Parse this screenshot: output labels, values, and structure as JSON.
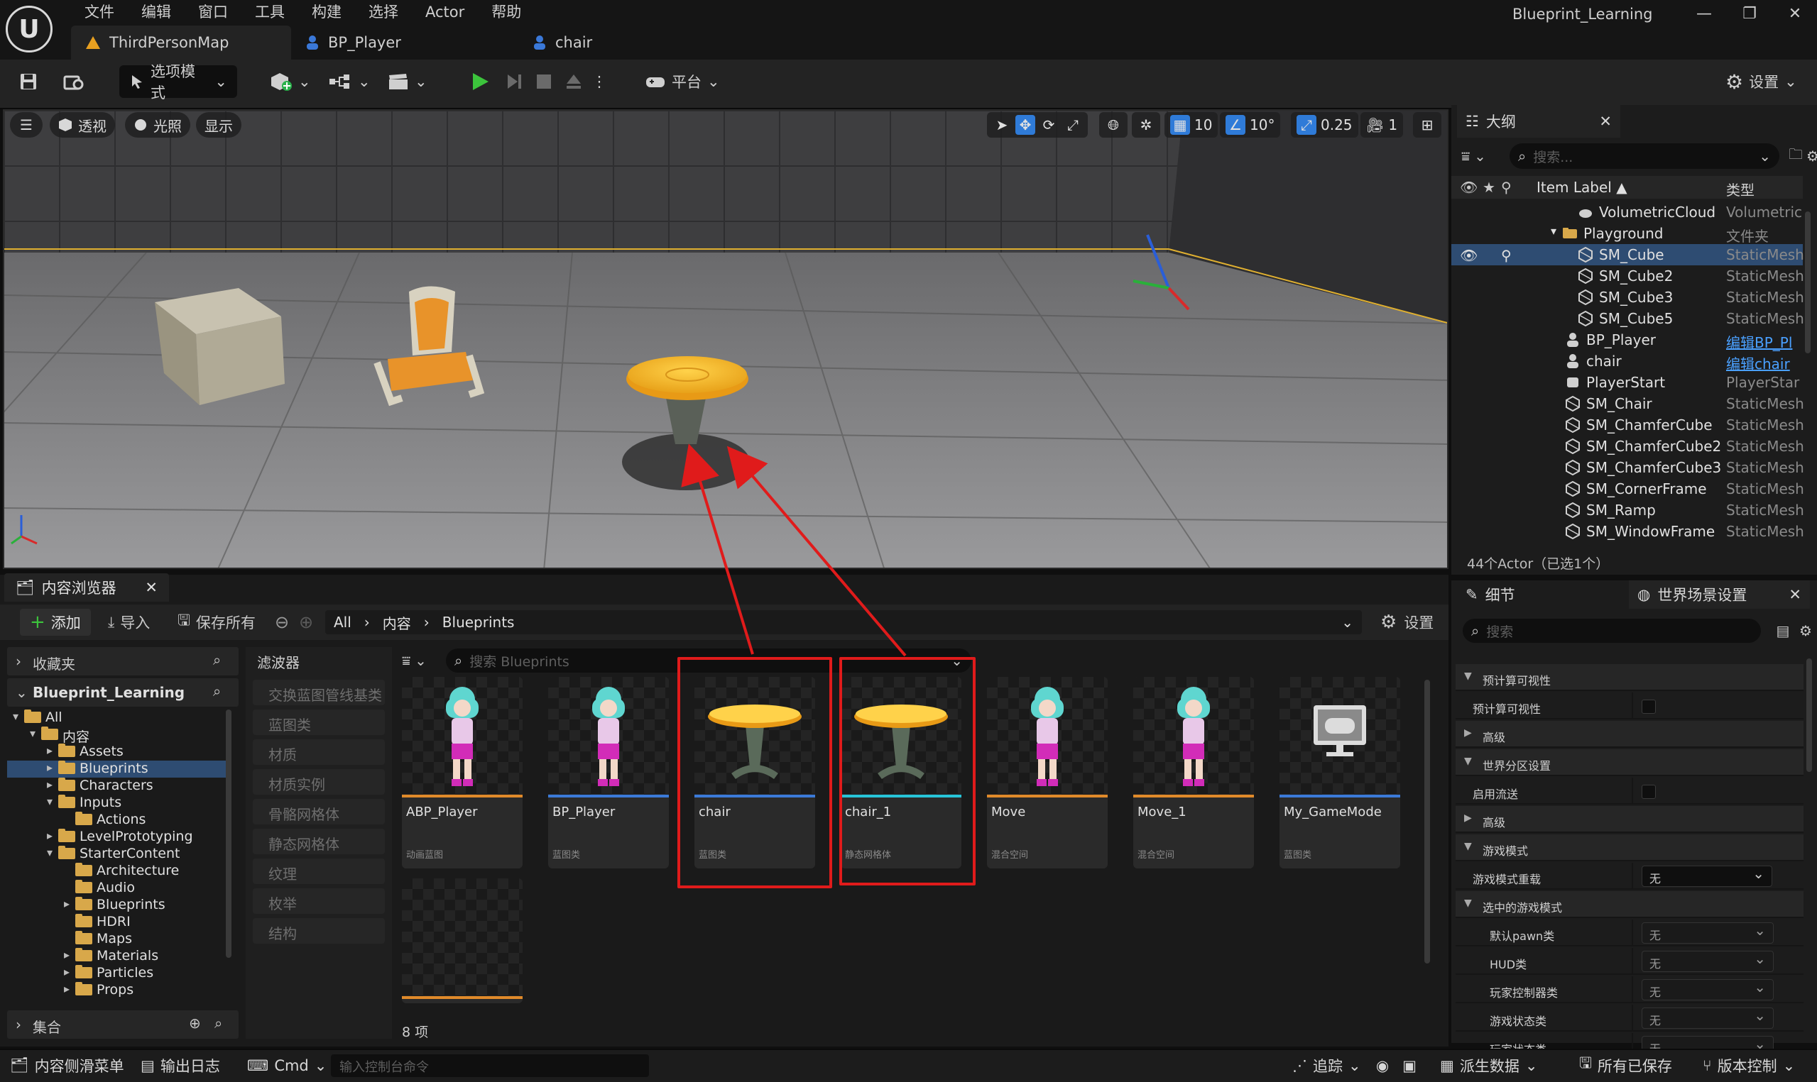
{
  "menu": [
    "文件",
    "编辑",
    "窗口",
    "工具",
    "构建",
    "选择",
    "Actor",
    "帮助"
  ],
  "tabs": [
    {
      "label": "ThirdPersonMap",
      "icon": "map-warning-icon"
    },
    {
      "label": "BP_Player",
      "icon": "blueprint-person-icon"
    },
    {
      "label": "chair",
      "icon": "blueprint-person-icon"
    }
  ],
  "window_title": "Blueprint_Learning",
  "toolbar": {
    "mode_label": "选项模式",
    "platform_label": "平台",
    "settings_label": "设置"
  },
  "viewport": {
    "perspective_label": "透视",
    "lit_label": "光照",
    "show_label": "显示",
    "grid_snap": "10",
    "rotation_snap": "10°",
    "scale_snap": "0.25",
    "camera_speed": "1"
  },
  "outliner": {
    "tab_label": "大纲",
    "search_placeholder": "搜索...",
    "col_label": "Item Label ▲",
    "col_type": "类型",
    "rows": [
      {
        "name": "VolumetricCloud",
        "type": "Volumetric",
        "indent": 1,
        "icon": "cloud-icon"
      },
      {
        "name": "Playground",
        "type": "文件夹",
        "indent": 0,
        "icon": "folder-icon"
      },
      {
        "name": "SM_Cube",
        "type": "StaticMesh",
        "indent": 1,
        "icon": "static-mesh-icon",
        "selected": true
      },
      {
        "name": "SM_Cube2",
        "type": "StaticMesh",
        "indent": 1,
        "icon": "static-mesh-icon"
      },
      {
        "name": "SM_Cube3",
        "type": "StaticMesh",
        "indent": 1,
        "icon": "static-mesh-icon"
      },
      {
        "name": "SM_Cube5",
        "type": "StaticMesh",
        "indent": 1,
        "icon": "static-mesh-icon"
      },
      {
        "name": "BP_Player",
        "type": "编辑BP_Pl",
        "indent": 0,
        "icon": "pawn-icon",
        "link": true
      },
      {
        "name": "chair",
        "type": "编辑chair",
        "indent": 0,
        "icon": "pawn-icon",
        "link": true
      },
      {
        "name": "PlayerStart",
        "type": "PlayerStar",
        "indent": 0,
        "icon": "player-start-icon"
      },
      {
        "name": "SM_Chair",
        "type": "StaticMesh",
        "indent": 0,
        "icon": "static-mesh-icon"
      },
      {
        "name": "SM_ChamferCube",
        "type": "StaticMesh",
        "indent": 0,
        "icon": "static-mesh-icon"
      },
      {
        "name": "SM_ChamferCube2",
        "type": "StaticMesh",
        "indent": 0,
        "icon": "static-mesh-icon"
      },
      {
        "name": "SM_ChamferCube3",
        "type": "StaticMesh",
        "indent": 0,
        "icon": "static-mesh-icon"
      },
      {
        "name": "SM_CornerFrame",
        "type": "StaticMesh",
        "indent": 0,
        "icon": "static-mesh-icon"
      },
      {
        "name": "SM_Ramp",
        "type": "StaticMesh",
        "indent": 0,
        "icon": "static-mesh-icon"
      },
      {
        "name": "SM_WindowFrame",
        "type": "StaticMesh",
        "indent": 0,
        "icon": "static-mesh-icon"
      }
    ],
    "footer": "44个Actor（已选1个）"
  },
  "details": {
    "tab1": "细节",
    "tab2": "世界场景设置",
    "search_placeholder": "搜索",
    "rows": [
      {
        "label": "预计算可视性",
        "kind": "section",
        "open": true
      },
      {
        "label": "预计算可视性",
        "kind": "check"
      },
      {
        "label": "高级",
        "kind": "section",
        "open": false
      },
      {
        "label": "世界分区设置",
        "kind": "section",
        "open": true
      },
      {
        "label": "启用流送",
        "kind": "check"
      },
      {
        "label": "高级",
        "kind": "section",
        "open": false
      },
      {
        "label": "游戏模式",
        "kind": "section",
        "open": true
      },
      {
        "label": "游戏模式重载",
        "kind": "select",
        "value": "无"
      },
      {
        "label": "选中的游戏模式",
        "kind": "section",
        "open": true
      },
      {
        "label": "默认pawn类",
        "kind": "select2",
        "value": "无"
      },
      {
        "label": "HUD类",
        "kind": "select2",
        "value": "无"
      },
      {
        "label": "玩家控制器类",
        "kind": "select2",
        "value": "无"
      },
      {
        "label": "游戏状态类",
        "kind": "select2",
        "value": "无"
      },
      {
        "label": "玩家状态类",
        "kind": "select2",
        "value": "无"
      }
    ]
  },
  "content_browser": {
    "tab_label": "内容浏览器",
    "add_label": "添加",
    "import_label": "导入",
    "save_all_label": "保存所有",
    "breadcrumb": [
      "All",
      "内容",
      "Blueprints"
    ],
    "settings_label": "设置",
    "favorites_label": "收藏夹",
    "project_label": "Blueprint_Learning",
    "collections_label": "集合",
    "filters_label": "滤波器",
    "search_placeholder": "搜索 Blueprints",
    "item_count": "8 项",
    "tree": [
      {
        "name": "All",
        "level": 0,
        "open": true
      },
      {
        "name": "内容",
        "level": 1,
        "open": true
      },
      {
        "name": "Assets",
        "level": 2
      },
      {
        "name": "Blueprints",
        "level": 2,
        "selected": true
      },
      {
        "name": "Characters",
        "level": 2
      },
      {
        "name": "Inputs",
        "level": 2,
        "open": true
      },
      {
        "name": "Actions",
        "level": 3
      },
      {
        "name": "LevelPrototyping",
        "level": 2
      },
      {
        "name": "StarterContent",
        "level": 2,
        "open": true
      },
      {
        "name": "Architecture",
        "level": 3
      },
      {
        "name": "Audio",
        "level": 3
      },
      {
        "name": "Blueprints",
        "level": 3
      },
      {
        "name": "HDRI",
        "level": 3
      },
      {
        "name": "Maps",
        "level": 3
      },
      {
        "name": "Materials",
        "level": 3
      },
      {
        "name": "Particles",
        "level": 3
      },
      {
        "name": "Props",
        "level": 3
      }
    ],
    "filters": [
      "交换蓝图管线基类",
      "蓝图类",
      "材质",
      "材质实例",
      "骨骼网格体",
      "静态网格体",
      "纹理",
      "枚举",
      "结构"
    ],
    "assets": [
      {
        "name": "ABP_Player",
        "type": "动画蓝图",
        "bar": "#e08a2a",
        "thumb": "character"
      },
      {
        "name": "BP_Player",
        "type": "蓝图类",
        "bar": "#3b7ad8",
        "thumb": "character"
      },
      {
        "name": "chair",
        "type": "蓝图类",
        "bar": "#3b7ad8",
        "thumb": "table"
      },
      {
        "name": "chair_1",
        "type": "静态网格体",
        "bar": "#27c4d8",
        "thumb": "table"
      },
      {
        "name": "Move",
        "type": "混合空间",
        "bar": "#e08a2a",
        "thumb": "character"
      },
      {
        "name": "Move_1",
        "type": "混合空间",
        "bar": "#e08a2a",
        "thumb": "character"
      },
      {
        "name": "My_GameMode",
        "type": "蓝图类",
        "bar": "#3b7ad8",
        "thumb": "gamemode"
      },
      {
        "name": "",
        "type": "",
        "bar": "#e08a2a",
        "thumb": "empty"
      }
    ]
  },
  "statusbar": {
    "content_drawer": "内容侧滑菜单",
    "output_log": "输出日志",
    "cmd": "Cmd",
    "console_placeholder": "输入控制台命令",
    "trace": "追踪",
    "derived_data": "派生数据",
    "all_saved": "所有已保存",
    "source_control": "版本控制"
  }
}
